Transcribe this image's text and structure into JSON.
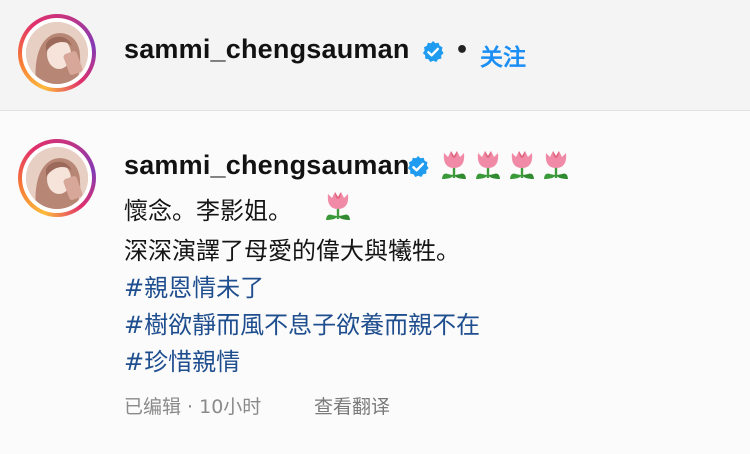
{
  "post_header": {
    "username": "sammi_chengsauman",
    "separator": "•",
    "follow_label": "关注"
  },
  "comment": {
    "username": "sammi_chengsauman",
    "lines": [
      "懷念。李影姐。",
      "深深演譯了母愛的偉大與犧牲。"
    ],
    "hashtags": [
      "#親恩情未了",
      "#樹欲靜而風不息子欲養而親不在",
      "#珍惜親情"
    ],
    "meta": {
      "edited": "已编辑 · 10小时",
      "translate": "查看翻译"
    }
  },
  "icons": [
    "verified-badge-icon",
    "tulip-emoji"
  ],
  "colors": {
    "link_blue": "#1a8ef5",
    "hashtag_blue": "#1f4e8f",
    "verified_blue": "#1f9bf0",
    "header_bg": "#f4f4f5"
  }
}
